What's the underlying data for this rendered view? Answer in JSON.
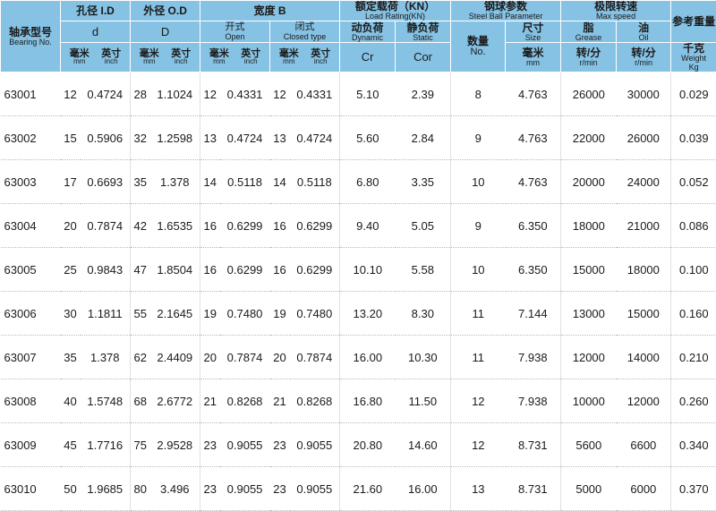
{
  "header": {
    "model": {
      "zh": "轴承型号",
      "en": "Bearing No."
    },
    "bore": {
      "title": "孔径 I.D",
      "symbol": "d",
      "mm_zh": "毫米",
      "mm_en": "mm",
      "inch_zh": "英寸",
      "inch_en": "inch"
    },
    "outer": {
      "title": "外径 O.D",
      "symbol": "D",
      "mm_zh": "毫米",
      "mm_en": "mm",
      "inch_zh": "英寸",
      "inch_en": "inch"
    },
    "width": {
      "title": "宽度  B",
      "open": {
        "zh": "开式",
        "en": "Open",
        "mm_zh": "毫米",
        "mm_en": "mm",
        "inch_zh": "英寸",
        "inch_en": "inch"
      },
      "closed": {
        "zh": "闭式",
        "en": "Closed type",
        "mm_zh": "毫米",
        "mm_en": "mm",
        "inch_zh": "英寸",
        "inch_en": "inch"
      }
    },
    "load": {
      "title_zh": "额定载荷（KN）",
      "title_en": "Load Rating(KN)",
      "dynamic": {
        "zh": "动负荷",
        "en": "Dynamic",
        "symbol": "Cr"
      },
      "static": {
        "zh": "静负荷",
        "en": "Static",
        "symbol": "Cor"
      }
    },
    "ball": {
      "title_zh": "钢球参数",
      "title_en": "Steel Ball Parameter",
      "count": {
        "zh": "数量",
        "en": "No."
      },
      "size": {
        "zh": "尺寸",
        "en": "Size",
        "unit_zh": "毫米",
        "unit_en": "mm"
      }
    },
    "speed": {
      "title_zh": "极限转速",
      "title_en": "Max speed",
      "grease": {
        "zh": "脂",
        "en": "Grease",
        "unit_zh": "转/分",
        "unit_en": "r/min"
      },
      "oil": {
        "zh": "油",
        "en": "Oil",
        "unit_zh": "转/分",
        "unit_en": "r/min"
      }
    },
    "weight": {
      "title_zh": "参考重量",
      "unit_zh": "千克",
      "en": "Weight",
      "unit_en": "Kg"
    }
  },
  "rows": [
    [
      "63001",
      "12",
      "0.4724",
      "28",
      "1.1024",
      "12",
      "0.4331",
      "12",
      "0.4331",
      "5.10",
      "2.39",
      "8",
      "4.763",
      "26000",
      "30000",
      "0.029"
    ],
    [
      "63002",
      "15",
      "0.5906",
      "32",
      "1.2598",
      "13",
      "0.4724",
      "13",
      "0.4724",
      "5.60",
      "2.84",
      "9",
      "4.763",
      "22000",
      "26000",
      "0.039"
    ],
    [
      "63003",
      "17",
      "0.6693",
      "35",
      "1.378",
      "14",
      "0.5118",
      "14",
      "0.5118",
      "6.80",
      "3.35",
      "10",
      "4.763",
      "20000",
      "24000",
      "0.052"
    ],
    [
      "63004",
      "20",
      "0.7874",
      "42",
      "1.6535",
      "16",
      "0.6299",
      "16",
      "0.6299",
      "9.40",
      "5.05",
      "9",
      "6.350",
      "18000",
      "21000",
      "0.086"
    ],
    [
      "63005",
      "25",
      "0.9843",
      "47",
      "1.8504",
      "16",
      "0.6299",
      "16",
      "0.6299",
      "10.10",
      "5.58",
      "10",
      "6.350",
      "15000",
      "18000",
      "0.100"
    ],
    [
      "63006",
      "30",
      "1.1811",
      "55",
      "2.1645",
      "19",
      "0.7480",
      "19",
      "0.7480",
      "13.20",
      "8.30",
      "11",
      "7.144",
      "13000",
      "15000",
      "0.160"
    ],
    [
      "63007",
      "35",
      "1.378",
      "62",
      "2.4409",
      "20",
      "0.7874",
      "20",
      "0.7874",
      "16.00",
      "10.30",
      "11",
      "7.938",
      "12000",
      "14000",
      "0.210"
    ],
    [
      "63008",
      "40",
      "1.5748",
      "68",
      "2.6772",
      "21",
      "0.8268",
      "21",
      "0.8268",
      "16.80",
      "11.50",
      "12",
      "7.938",
      "10000",
      "12000",
      "0.260"
    ],
    [
      "63009",
      "45",
      "1.7716",
      "75",
      "2.9528",
      "23",
      "0.9055",
      "23",
      "0.9055",
      "20.80",
      "14.60",
      "12",
      "8.731",
      "5600",
      "6600",
      "0.340"
    ],
    [
      "63010",
      "50",
      "1.9685",
      "80",
      "3.496",
      "23",
      "0.9055",
      "23",
      "0.9055",
      "21.60",
      "16.00",
      "13",
      "8.731",
      "5000",
      "6000",
      "0.370"
    ]
  ]
}
